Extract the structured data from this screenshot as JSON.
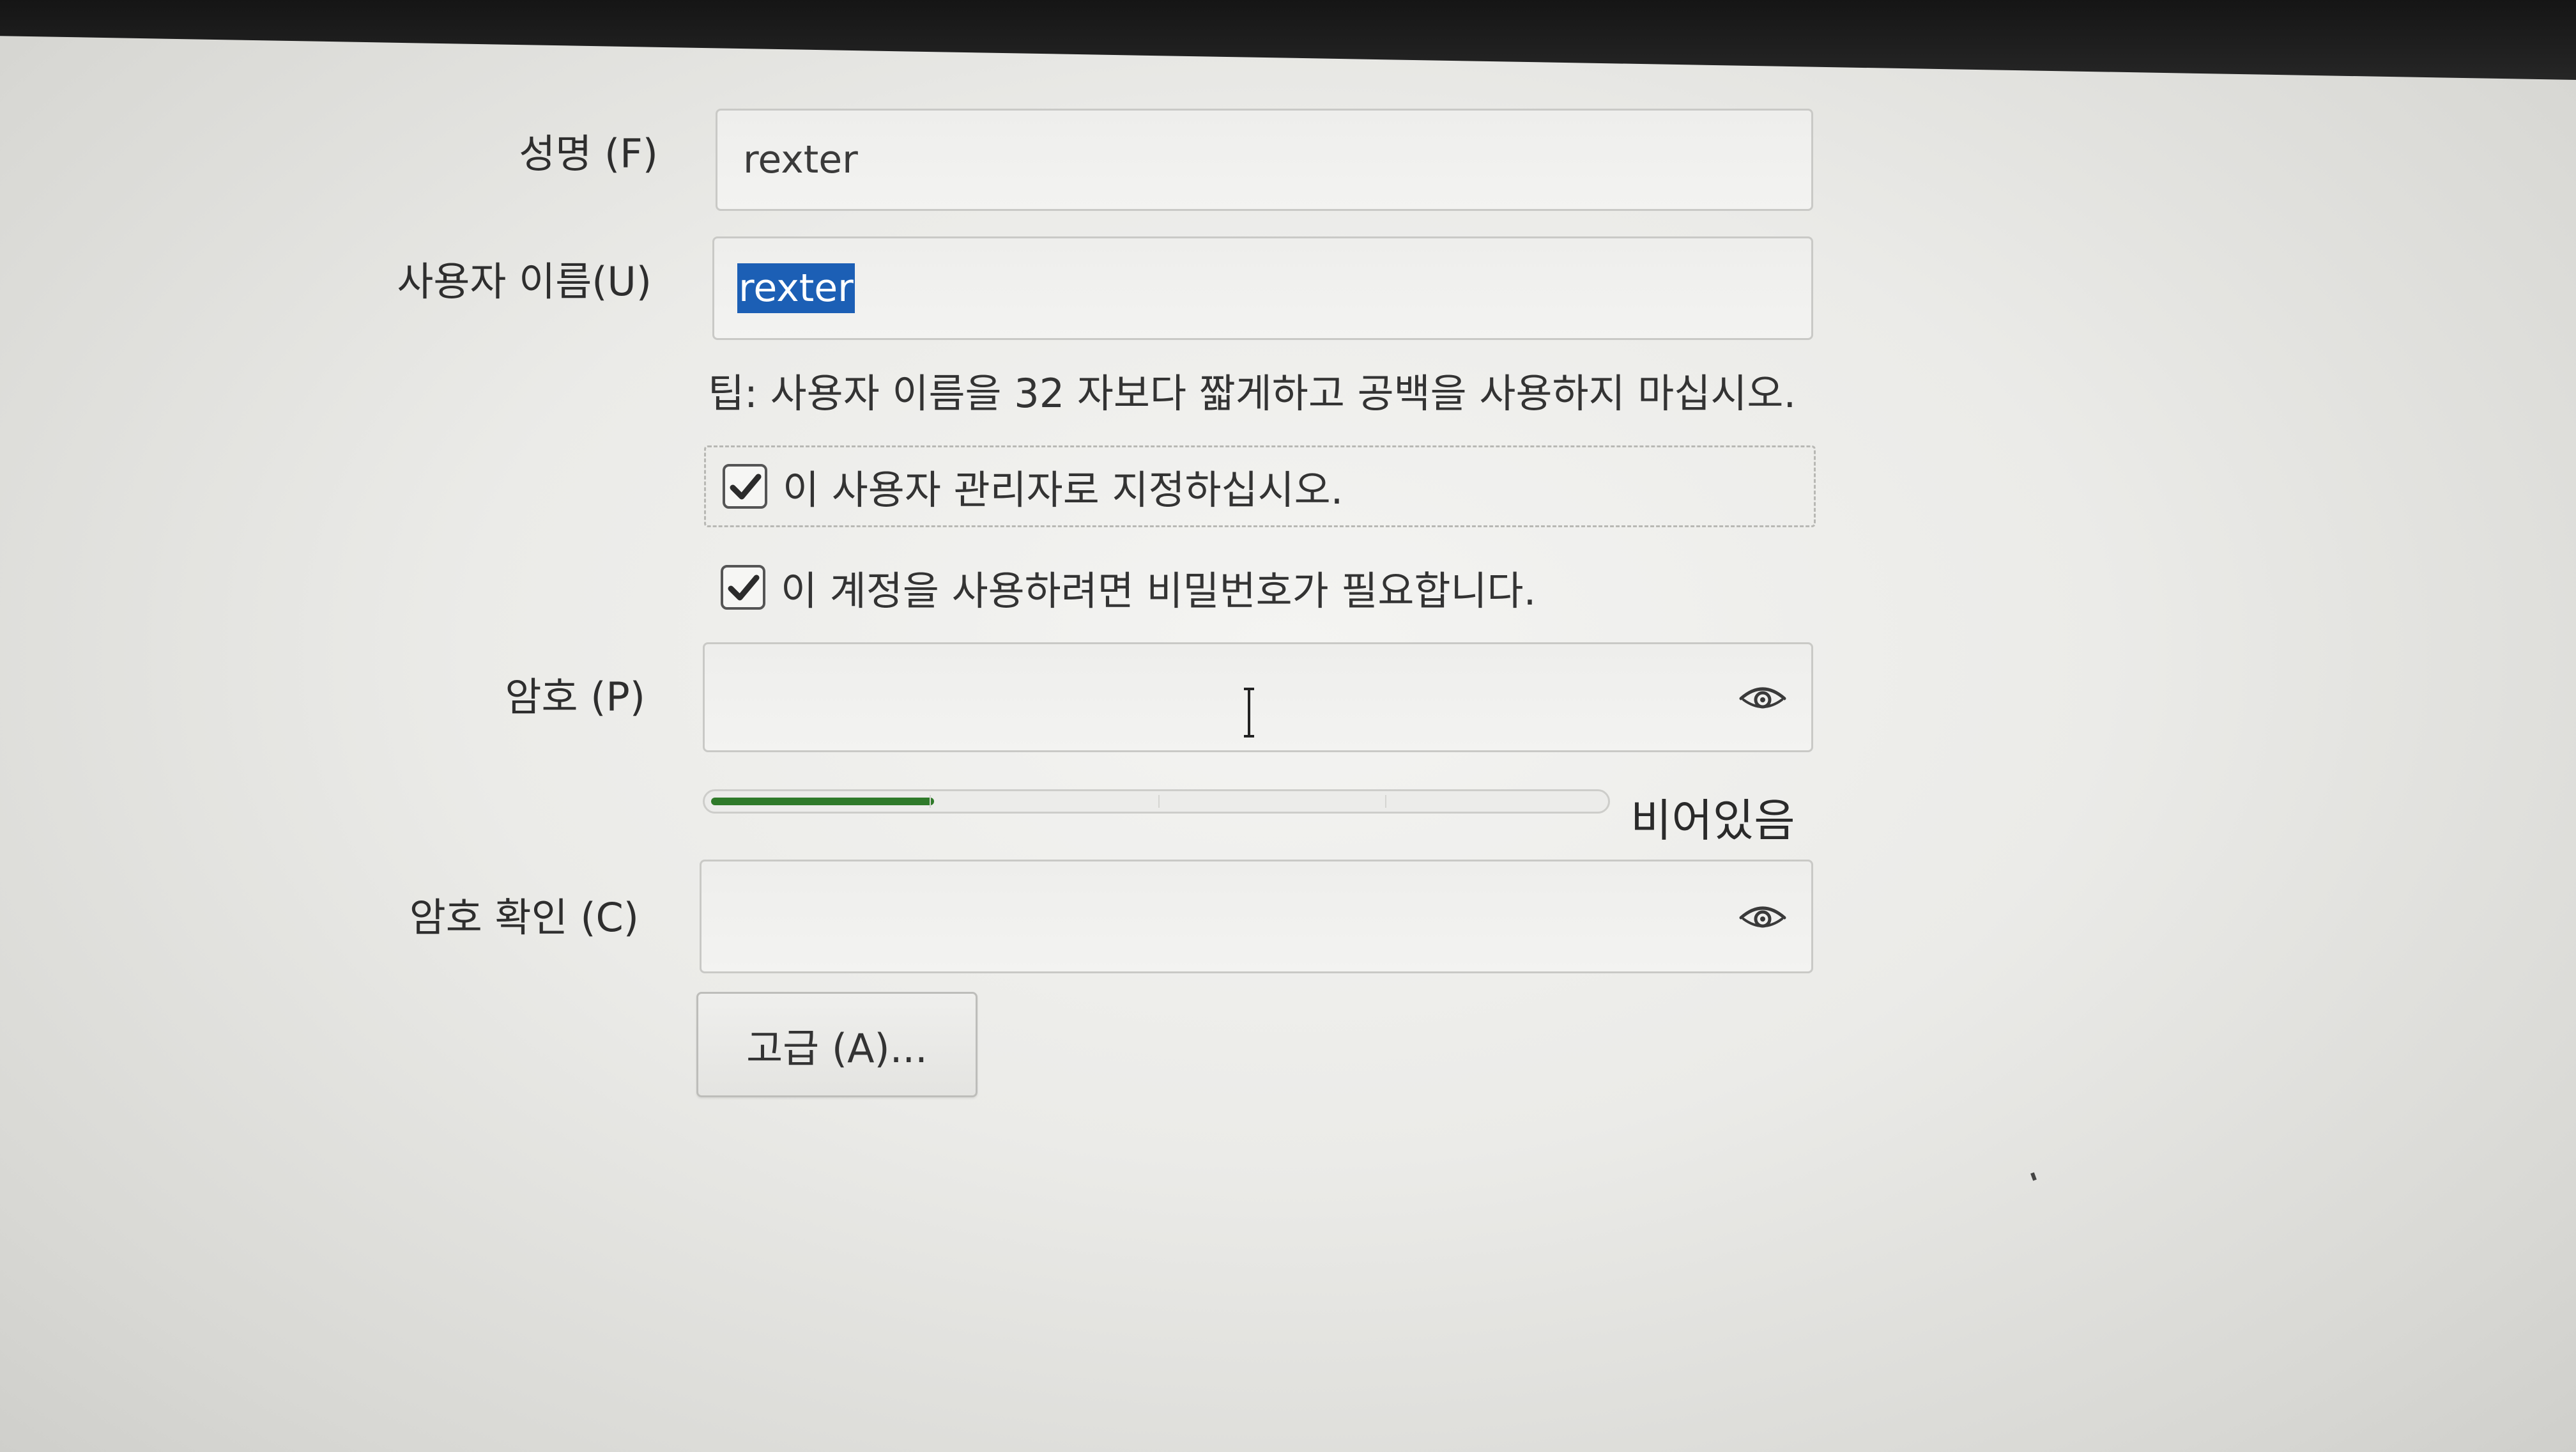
{
  "form": {
    "full_name": {
      "label": "성명 (F)",
      "value": "rexter"
    },
    "username": {
      "label": "사용자 이름(U)",
      "value": "rexter"
    },
    "tip": "팁: 사용자 이름을 32 자보다 짧게하고 공백을 사용하지 마십시오.",
    "admin_checkbox": {
      "label": "이 사용자 관리자로 지정하십시오.",
      "checked": true
    },
    "require_password_checkbox": {
      "label": "이 계정을 사용하려면 비밀번호가 필요합니다.",
      "checked": true
    },
    "password": {
      "label": "암호 (P)",
      "value": ""
    },
    "strength": {
      "text": "비어있음",
      "level": 0.25
    },
    "confirm_password": {
      "label": "암호 확인 (C)",
      "value": ""
    },
    "advanced_button": {
      "label": "고급 (A)..."
    }
  },
  "icons": {
    "checkbox_mark": "check-icon",
    "password_toggle": "eye-icon",
    "pointer": "text-cursor-icon"
  },
  "colors": {
    "selection": "#1c5fb5",
    "strength_fill": "#2f7a2a"
  }
}
